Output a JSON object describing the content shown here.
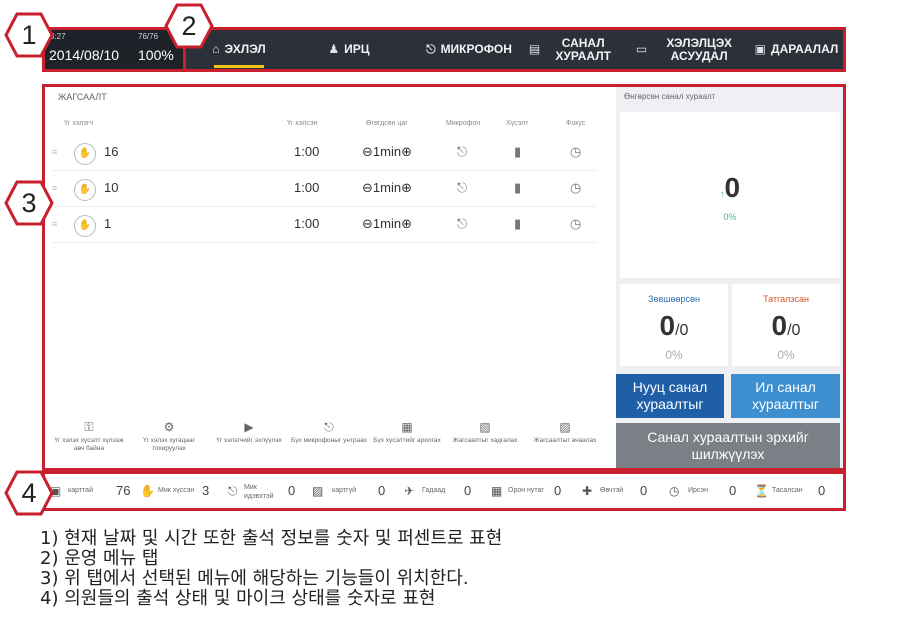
{
  "badges": [
    "1",
    "2",
    "3",
    "4"
  ],
  "status": {
    "time": "3:27",
    "attendance": "76/76",
    "date": "2014/08/10",
    "percent": "100%"
  },
  "tabs": [
    {
      "label": "ЭХЛЭЛ",
      "icon": "home-icon",
      "active": true
    },
    {
      "label": "ИРЦ",
      "icon": "users-icon",
      "active": false
    },
    {
      "label": "МИКРОФОН",
      "icon": "microphone-icon",
      "active": false
    },
    {
      "label": "САНАЛ ХУРААЛТ",
      "icon": "ballot-icon",
      "active": false
    },
    {
      "label": "ХЭЛЭЛЦЭХ АСУУДАЛ",
      "icon": "monitor-icon",
      "active": false
    },
    {
      "label": "ДАРААЛАЛ",
      "icon": "list-icon",
      "active": false
    }
  ],
  "queue": {
    "title": "ЖАГСААЛТ",
    "columns": [
      "Үг хэлэгч",
      "Үг хэлсэн",
      "Өгөгдсөн цаг",
      "Микрофон",
      "Хүсэлт",
      "Фокус"
    ],
    "rows": [
      {
        "speaker": "16",
        "spoken": "1:00",
        "time": "1min"
      },
      {
        "speaker": "10",
        "spoken": "1:00",
        "time": "1min"
      },
      {
        "speaker": "1",
        "spoken": "1:00",
        "time": "1min"
      }
    ],
    "toolbar": [
      "Үг хэлэх хүсэлт хүлээж авч байна",
      "Үг хэлэх хугацааг тохируулах",
      "Үг хэлэгчийг эхлүүлэх",
      "Бүх микрофоныг унтраах",
      "Бүх хүсэлтийг арилгах",
      "Жагсаалтыг хадгалах",
      "Жагсаалтыг ачаалах"
    ]
  },
  "vote": {
    "title": "Өнгөрсөн санал хураалт",
    "total": "0",
    "total_percent": "0%",
    "approved_label": "Зөвшөөрсөн",
    "approved_value": "0",
    "approved_total": "/0",
    "approved_percent": "0%",
    "rejected_label": "Татгалзсан",
    "rejected_value": "0",
    "rejected_total": "/0",
    "rejected_percent": "0%",
    "secret_btn": "Нууц санал хураалтыг",
    "open_btn": "Ил санал хураалтыг",
    "transfer_btn": "Санал хураалтын эрхийг шилжүүлэх",
    "colors": {
      "approved": "#2f6fb0",
      "rejected": "#d9542b",
      "secret": "#1f5fa8",
      "open": "#3d8fd0",
      "transfer": "#7b7f86"
    }
  },
  "bottom_stats": [
    {
      "icon": "card-icon",
      "label": "карттай",
      "value": "76"
    },
    {
      "icon": "hand-icon",
      "label": "Мик хүссэн",
      "value": "3"
    },
    {
      "icon": "microphone-icon",
      "label": "Мик идэвхтэй",
      "value": "0"
    },
    {
      "icon": "card-off-icon",
      "label": "картгүй",
      "value": "0"
    },
    {
      "icon": "plane-icon",
      "label": "Гадаад",
      "value": "0"
    },
    {
      "icon": "building-icon",
      "label": "Орон нутаг",
      "value": "0"
    },
    {
      "icon": "medical-cross-icon",
      "label": "Өвчтэй",
      "value": "0"
    },
    {
      "icon": "clock-icon",
      "label": "Ирсэн",
      "value": "0"
    },
    {
      "icon": "hourglass-icon",
      "label": "Тасалсан",
      "value": "0"
    }
  ],
  "notes": [
    "1) 현재 날짜 및 시간 또한 출석 정보를 숫자 및 퍼센트로 표현",
    "2) 운영 메뉴 탭",
    "3) 위 탭에서 선택된 메뉴에 해당하는 기능들이 위치한다.",
    "4) 의원들의 출석 상태 및 마이크 상태를 숫자로 표현"
  ]
}
